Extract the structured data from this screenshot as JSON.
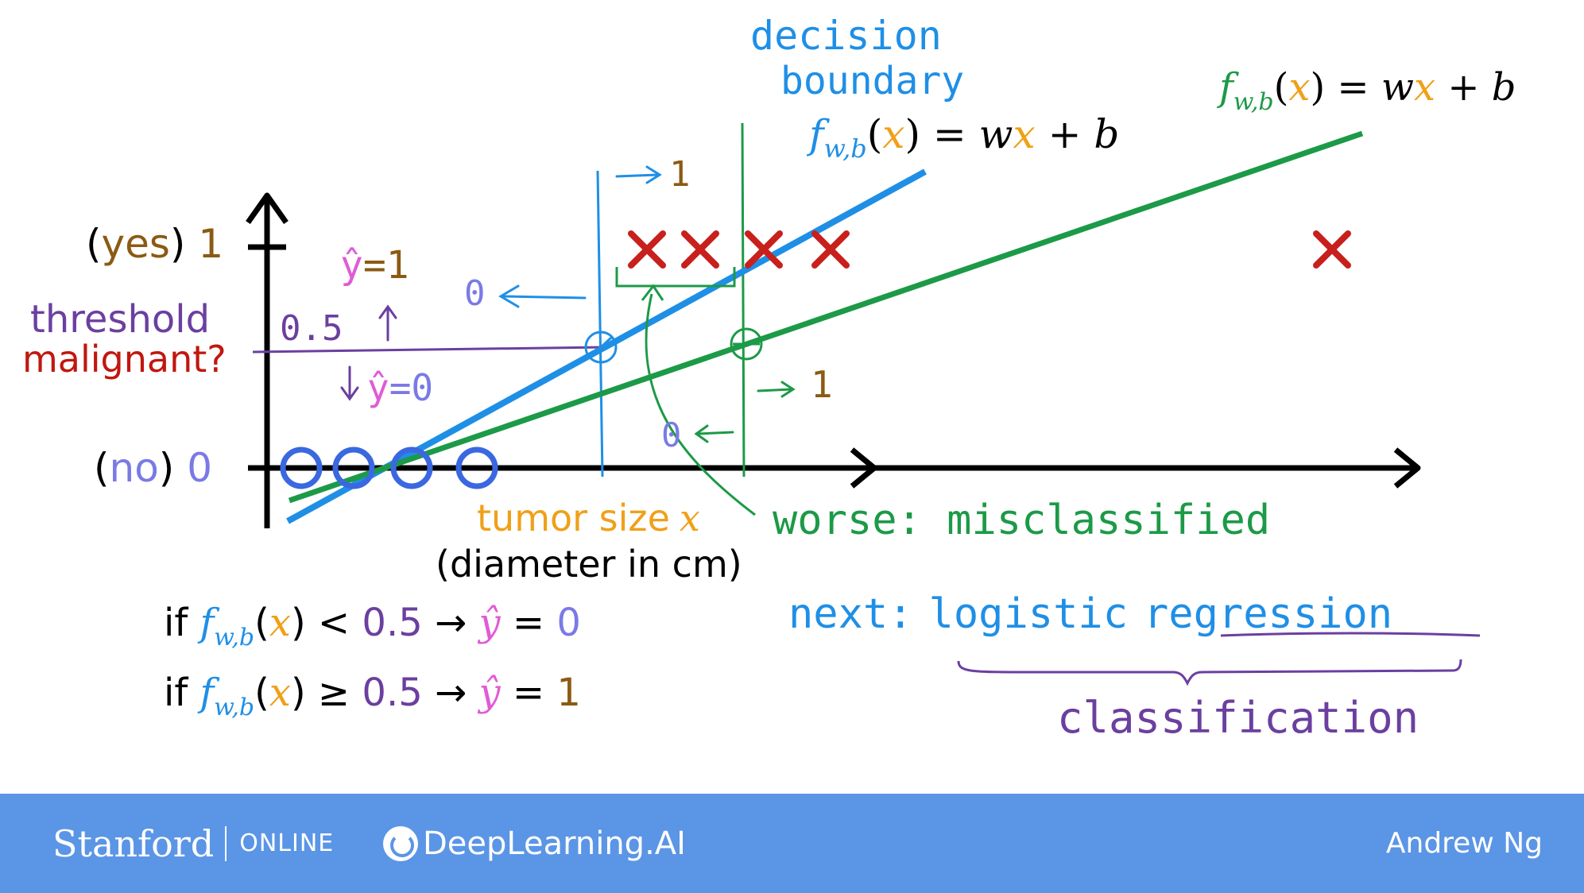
{
  "diagram": {
    "labels": {
      "yes_word": "yes",
      "yes_value": "1",
      "no_word": "no",
      "no_value": "0",
      "threshold": "threshold",
      "malignant": "malignant?",
      "half": "0.5",
      "yhat_eq_1": "=1",
      "yhat_eq_0": "=0",
      "zero_left": "0",
      "one_top": "1",
      "one_right": "1",
      "zero_bottom": "0",
      "decision_line1": "decision",
      "decision_line2": "boundary",
      "tumor_size": "tumor size",
      "tumor_x": "x",
      "diameter": "(diameter in cm)",
      "worse": "worse: misclassified",
      "next_prefix": "next:",
      "next_topic_a": "logistic",
      "next_topic_b": "regression",
      "classification": "classification"
    },
    "formulas": {
      "f": "f",
      "sub": "w,b",
      "x": "x",
      "eq_wx": "= w",
      "plus_b": " + b",
      "lt_part": " < ",
      "ge_part": " ≥ ",
      "half": "0.5",
      "arrow": " → ",
      "yhat": "ŷ",
      "eq": " = ",
      "zero": "0",
      "one": "1",
      "if": "if "
    },
    "colors": {
      "blue": "#1f8fe6",
      "green": "#1c9a47",
      "red": "#c8201c",
      "purple": "#6b3fa0",
      "brown": "#8b5a14",
      "orange": "#f0a018",
      "pink": "#e05bd6",
      "periwinkle": "#7a7ae6",
      "dark_red": "#c0170f",
      "black": "#000000"
    }
  },
  "footer": {
    "stanford": "Stanford",
    "online": "ONLINE",
    "dlai": "DeepLearning.AI",
    "author": "Andrew Ng"
  }
}
